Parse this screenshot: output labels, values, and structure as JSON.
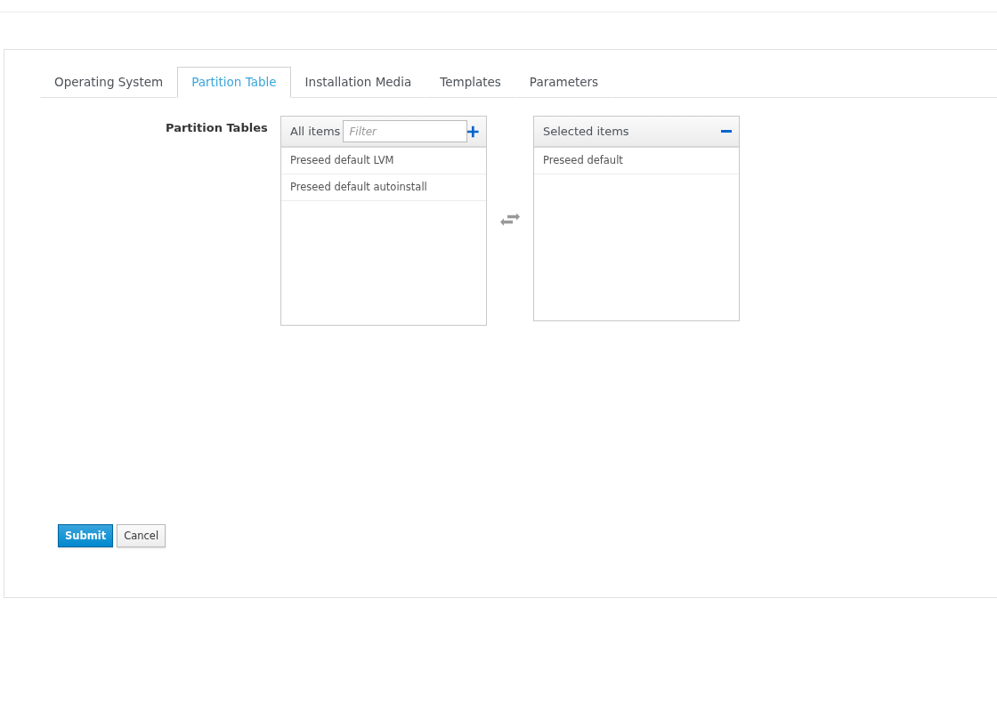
{
  "tabs": [
    {
      "label": "Operating System",
      "selected": false
    },
    {
      "label": "Partition Table",
      "selected": true
    },
    {
      "label": "Installation Media",
      "selected": false
    },
    {
      "label": "Templates",
      "selected": false
    },
    {
      "label": "Parameters",
      "selected": false
    }
  ],
  "field_label": "Partition Tables",
  "all_items": {
    "title": "All items",
    "filter": {
      "placeholder": "Filter"
    },
    "items": [
      "Preseed default LVM",
      "Preseed default autoinstall"
    ]
  },
  "selected_items": {
    "title": "Selected items",
    "items": [
      "Preseed default"
    ]
  },
  "buttons": [
    {
      "label": "Submit",
      "kind": "primary"
    },
    {
      "label": "Cancel",
      "kind": "default"
    }
  ]
}
